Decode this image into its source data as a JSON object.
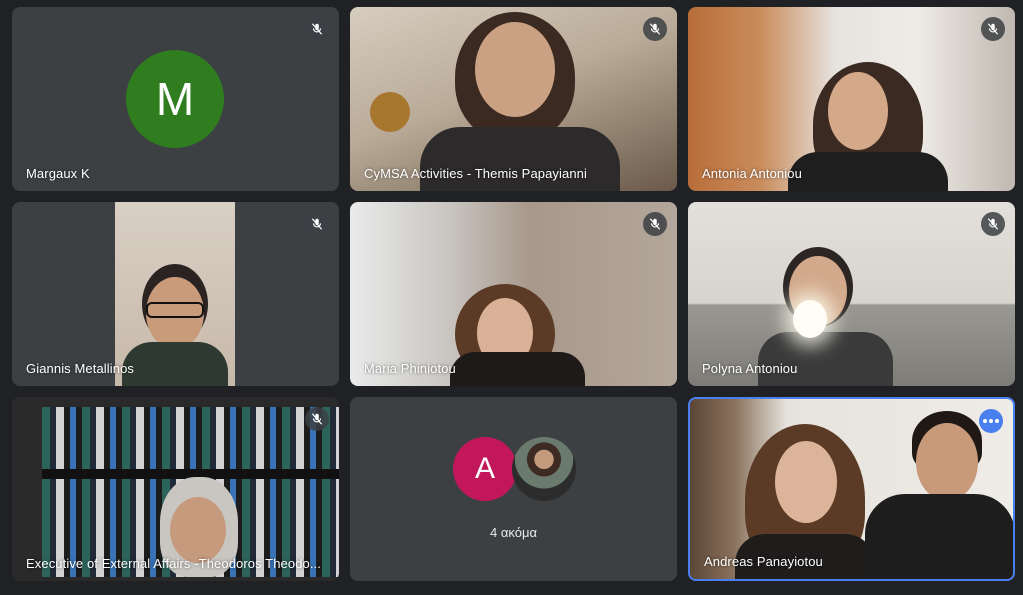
{
  "participants": [
    {
      "name": "Margaux K",
      "initial": "M",
      "muted": true,
      "avatar_color": "#2f7d1f"
    },
    {
      "name": "CyMSA Activities - Themis Papayianni",
      "muted": true
    },
    {
      "name": "Antonia Antoniou",
      "muted": true
    },
    {
      "name": "Giannis Metallinos",
      "muted": true
    },
    {
      "name": "Maria Phiniotou",
      "muted": true
    },
    {
      "name": "Polyna Antoniou",
      "muted": true
    },
    {
      "name": "Executive of External Affairs -Theodoros Theodo...",
      "muted": true
    },
    {
      "name": "Andreas Panayiotou",
      "active_speaker": true
    }
  ],
  "overflow": {
    "initial": "A",
    "avatar_color": "#c2185b",
    "label": "4 ακόμα"
  },
  "icons": {
    "mute": "mic-off-icon",
    "more": "more-options-icon"
  },
  "colors": {
    "background": "#202124",
    "tile": "#3c4043",
    "active_border": "#4a7ff0"
  }
}
